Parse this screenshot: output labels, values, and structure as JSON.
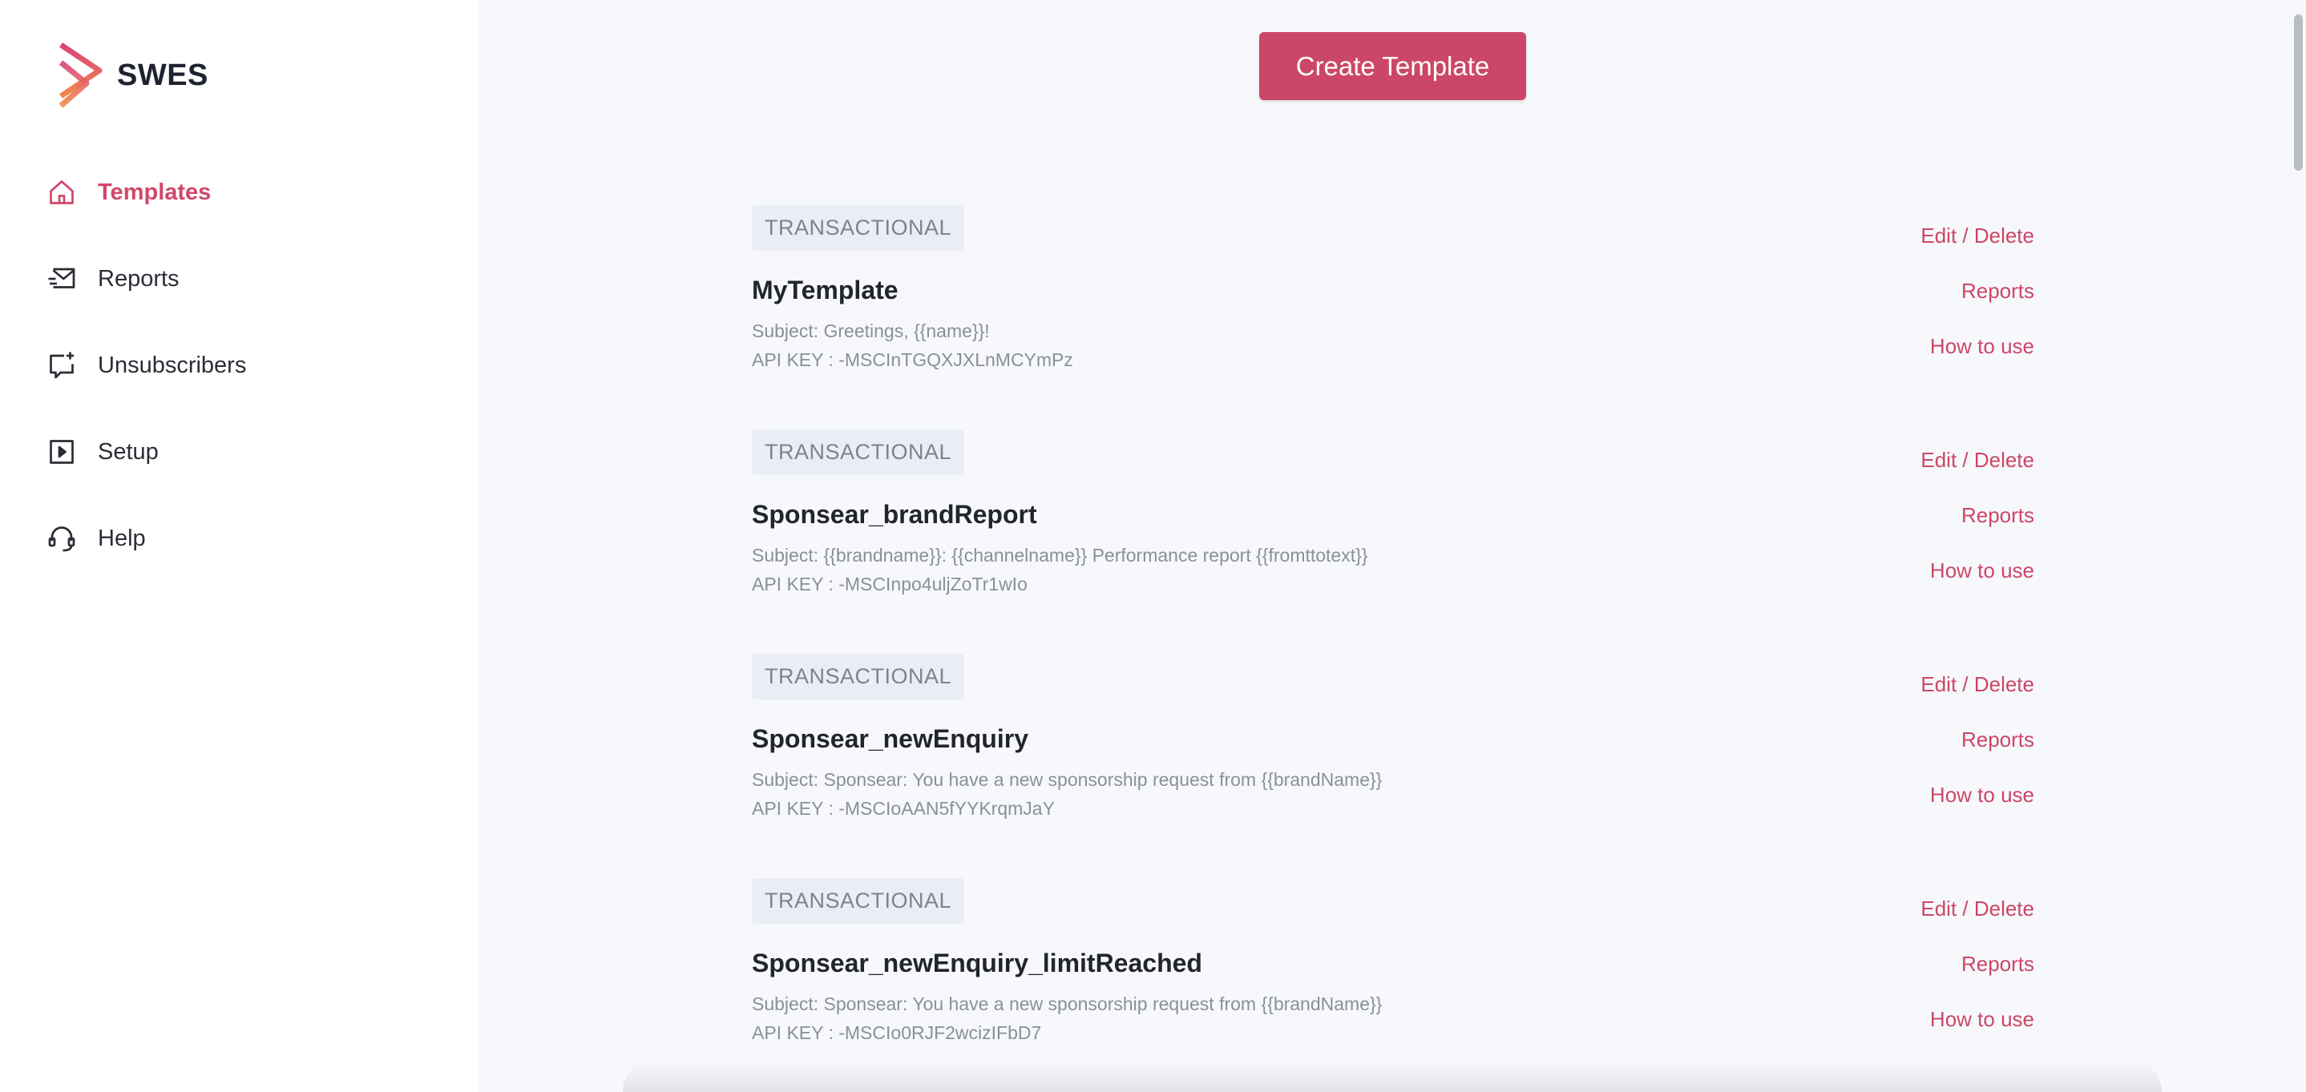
{
  "brand": {
    "name": "SWES"
  },
  "nav": {
    "items": [
      {
        "label": "Templates",
        "icon": "home-icon",
        "active": true
      },
      {
        "label": "Reports",
        "icon": "mail-send-icon",
        "active": false
      },
      {
        "label": "Unsubscribers",
        "icon": "message-add-icon",
        "active": false
      },
      {
        "label": "Setup",
        "icon": "play-square-icon",
        "active": false
      },
      {
        "label": "Help",
        "icon": "headset-icon",
        "active": false
      }
    ]
  },
  "main": {
    "create_label": "Create Template",
    "templates": [
      {
        "type": "TRANSACTIONAL",
        "name": "MyTemplate",
        "subject": "Subject: Greetings, {{name}}!",
        "api_key": "API KEY : -MSCInTGQXJXLnMCYmPz",
        "edit_label": "Edit / Delete",
        "reports_label": "Reports",
        "howto_label": "How to use"
      },
      {
        "type": "TRANSACTIONAL",
        "name": "Sponsear_brandReport",
        "subject": "Subject: {{brandname}}: {{channelname}} Performance report {{fromttotext}}",
        "api_key": "API KEY : -MSCInpo4uljZoTr1wIo",
        "edit_label": "Edit / Delete",
        "reports_label": "Reports",
        "howto_label": "How to use"
      },
      {
        "type": "TRANSACTIONAL",
        "name": "Sponsear_newEnquiry",
        "subject": "Subject: Sponsear: You have a new sponsorship request from {{brandName}}",
        "api_key": "API KEY : -MSCIoAAN5fYYKrqmJaY",
        "edit_label": "Edit / Delete",
        "reports_label": "Reports",
        "howto_label": "How to use"
      },
      {
        "type": "TRANSACTIONAL",
        "name": "Sponsear_newEnquiry_limitReached",
        "subject": "Subject: Sponsear: You have a new sponsorship request from {{brandName}}",
        "api_key": "API KEY : -MSCIo0RJF2wcizIFbD7",
        "edit_label": "Edit / Delete",
        "reports_label": "Reports",
        "howto_label": "How to use"
      }
    ]
  },
  "colors": {
    "accent": "#cc4767",
    "active_nav": "#d1476a",
    "badge_bg": "#eaedf3",
    "muted_text": "#8a8f99",
    "page_bg": "#f7f8fc"
  }
}
